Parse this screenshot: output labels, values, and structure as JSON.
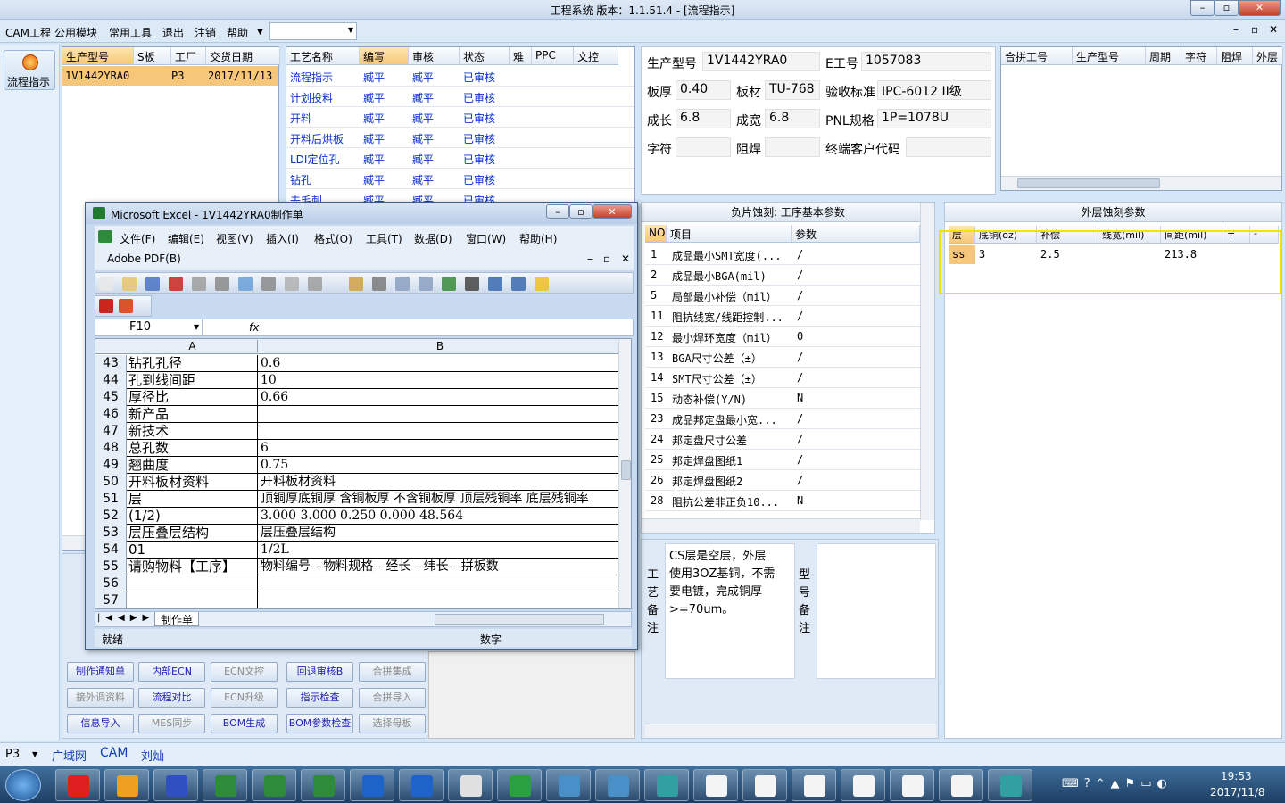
{
  "window": {
    "title": "工程系统  版本：1.1.51.4 - [流程指示]"
  },
  "menu": [
    "CAM工程",
    "公用模块",
    "常用工具",
    "退出",
    "注销",
    "帮助"
  ],
  "left": {
    "flow_btn": "流程指示"
  },
  "orders": {
    "headers": [
      "生产型号",
      "S板",
      "工厂",
      "交货日期"
    ],
    "rows": [
      [
        "1V1442YRA0",
        "",
        "P3",
        "2017/11/13"
      ]
    ]
  },
  "process": {
    "headers": [
      "工艺名称",
      "编写",
      "审核",
      "状态",
      "难",
      "PPC",
      "文控"
    ],
    "rows": [
      [
        "流程指示",
        "臧平",
        "臧平",
        "已审核"
      ],
      [
        "计划投料",
        "臧平",
        "臧平",
        "已审核"
      ],
      [
        "开料",
        "臧平",
        "臧平",
        "已审核"
      ],
      [
        "开料后烘板",
        "臧平",
        "臧平",
        "已审核"
      ],
      [
        "LDI定位孔",
        "臧平",
        "臧平",
        "已审核"
      ],
      [
        "钻孔",
        "臧平",
        "臧平",
        "已审核"
      ],
      [
        "去毛刺",
        "臧平",
        "臧平",
        "已审核"
      ]
    ]
  },
  "buttons": [
    {
      "label": "制作通知单",
      "disabled": false
    },
    {
      "label": "内部ECN",
      "disabled": false
    },
    {
      "label": "ECN文控",
      "disabled": true
    },
    {
      "label": "回退审核B",
      "disabled": false
    },
    {
      "label": "合拼集成",
      "disabled": true
    },
    {
      "label": "接外调资料",
      "disabled": true
    },
    {
      "label": "流程对比",
      "disabled": false
    },
    {
      "label": "ECN升级",
      "disabled": true
    },
    {
      "label": "指示检查",
      "disabled": false
    },
    {
      "label": "合拼导入",
      "disabled": true
    },
    {
      "label": "信息导入",
      "disabled": false
    },
    {
      "label": "MES同步",
      "disabled": true
    },
    {
      "label": "BOM生成",
      "disabled": false
    },
    {
      "label": "BOM参数检查",
      "disabled": false
    },
    {
      "label": "选择母板",
      "disabled": true
    }
  ],
  "info": {
    "model_label": "生产型号",
    "model": "1V1442YRA0",
    "eno_label": "E工号",
    "eno": "1057083",
    "thick_label": "板厚",
    "thick": "0.40",
    "mat_label": "板材",
    "mat": "TU-768",
    "std_label": "验收标准",
    "std": "IPC-6012 II级",
    "len_label": "成长",
    "len": "6.8",
    "wid_label": "成宽",
    "wid": "6.8",
    "pnl_label": "PNL规格",
    "pnl": "1P=1078U",
    "char_label": "字符",
    "char": "",
    "mask_label": "阻焊",
    "mask": "",
    "cust_label": "终端客户代码",
    "cust": ""
  },
  "merge": {
    "headers": [
      "合拼工号",
      "生产型号",
      "周期",
      "字符",
      "阻焊",
      "外层"
    ]
  },
  "etch": {
    "title": "负片蚀刻: 工序基本参数",
    "headers": [
      "NO",
      "项目",
      "参数"
    ],
    "rows": [
      [
        "1",
        "成品最小SMT宽度(...",
        "/"
      ],
      [
        "2",
        "成品最小BGA(mil)",
        "/"
      ],
      [
        "5",
        "局部最小补偿（mil）",
        "/"
      ],
      [
        "11",
        "阻抗线宽/线距控制...",
        "/"
      ],
      [
        "12",
        "最小焊环宽度（mil）",
        "0"
      ],
      [
        "13",
        "BGA尺寸公差（±）",
        "/"
      ],
      [
        "14",
        "SMT尺寸公差（±）",
        "/"
      ],
      [
        "15",
        "动态补偿(Y/N)",
        "N"
      ],
      [
        "23",
        "成品邦定盘最小宽...",
        "/"
      ],
      [
        "24",
        "邦定盘尺寸公差",
        "/"
      ],
      [
        "25",
        "邦定焊盘图纸1",
        "/"
      ],
      [
        "26",
        "邦定焊盘图纸2",
        "/"
      ],
      [
        "28",
        "阻抗公差非正负10...",
        "N"
      ]
    ]
  },
  "outer": {
    "title": "外层蚀刻参数",
    "headers": [
      "层",
      "底铜(oz)",
      "补偿",
      "线宽(mil)",
      "间距(mil)",
      "+",
      "-"
    ],
    "rows": [
      [
        "ss",
        "3",
        "2.5",
        "",
        "213.8",
        "",
        ""
      ]
    ]
  },
  "remark": {
    "craft_label": "工艺备注",
    "craft": "CS层是空层，外层使用3OZ基铜，不需要电镀，完成铜厚>=70um。",
    "model_label": "型号备注"
  },
  "excel": {
    "title": "Microsoft Excel - 1V1442YRA0制作单",
    "menu": [
      "文件(F)",
      "编辑(E)",
      "视图(V)",
      "插入(I)",
      "格式(O)",
      "工具(T)",
      "数据(D)",
      "窗口(W)",
      "帮助(H)"
    ],
    "pdf": "Adobe PDF(B)",
    "cell": "F10",
    "fx": "fx",
    "colA": "A",
    "colB": "B",
    "rows": [
      [
        "43",
        "钻孔孔径",
        "0.6"
      ],
      [
        "44",
        "孔到线间距",
        "10"
      ],
      [
        "45",
        "厚径比",
        "0.66"
      ],
      [
        "46",
        "新产品",
        ""
      ],
      [
        "47",
        "新技术",
        ""
      ],
      [
        "48",
        "总孔数",
        "6"
      ],
      [
        "49",
        "翘曲度",
        "0.75"
      ],
      [
        "50",
        "开料板材资料",
        "开料板材资料"
      ],
      [
        "51",
        "层",
        "顶铜厚底铜厚  含铜板厚  不含铜板厚  顶层残铜率  底层残铜率"
      ],
      [
        "52",
        "(1/2)",
        "3.000   3.000        0.250      0.000      48.564"
      ],
      [
        "53",
        "层压叠层结构",
        "层压叠层结构"
      ],
      [
        "54",
        "01",
        "1/2L"
      ],
      [
        "55",
        "请购物料【工序】",
        "物料编号---物料规格---经长---纬长---拼板数"
      ],
      [
        "56",
        "",
        ""
      ],
      [
        "57",
        "",
        ""
      ]
    ],
    "sheet": "制作单",
    "status_left": "就绪",
    "status_num": "数字"
  },
  "statusbar": {
    "factory": "P3",
    "net": "广域网",
    "dept": "CAM",
    "user": "刘灿"
  },
  "clock": {
    "time": "19:53",
    "date": "2017/11/8"
  },
  "colors": {
    "highlight": "#f2e400",
    "selected": "#f6c77a",
    "link": "#0a2fd0"
  }
}
